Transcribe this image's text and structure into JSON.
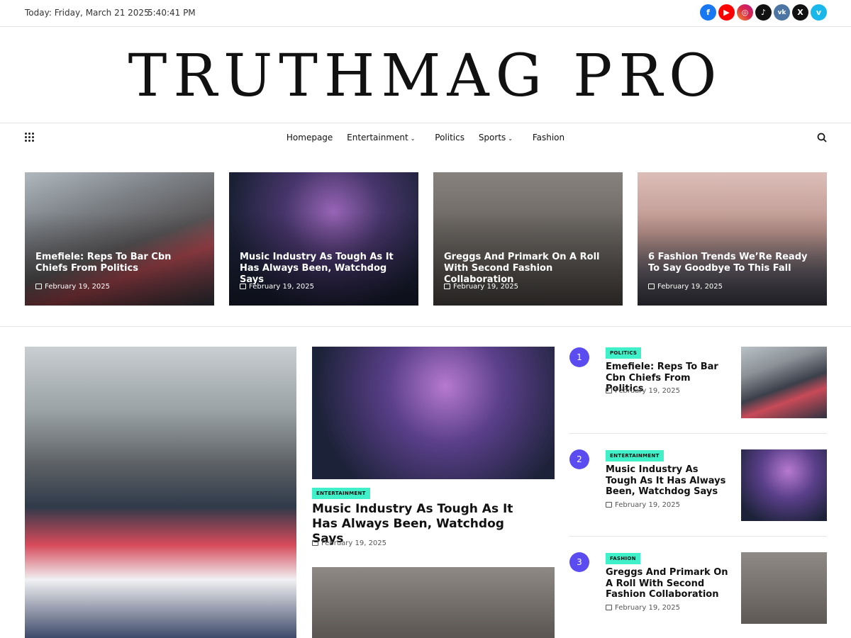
{
  "topbar": {
    "date": "Today: Friday, March 21 2025",
    "time": "5:40:41 PM",
    "socials": [
      {
        "name": "facebook",
        "glyph": "f",
        "color": "#1877f2"
      },
      {
        "name": "youtube",
        "glyph": "▶",
        "color": "#ff0000"
      },
      {
        "name": "instagram",
        "glyph": "◎",
        "color": "#c13584"
      },
      {
        "name": "tiktok",
        "glyph": "♪",
        "color": "#111111"
      },
      {
        "name": "vk",
        "glyph": "vk",
        "color": "#4c75a3"
      },
      {
        "name": "x",
        "glyph": "X",
        "color": "#111111"
      },
      {
        "name": "vimeo",
        "glyph": "v",
        "color": "#1ab7ea"
      }
    ]
  },
  "site": {
    "title": "TRUTHMAG PRO"
  },
  "nav": {
    "items": [
      {
        "label": "Homepage"
      },
      {
        "label": "Entertainment"
      },
      {
        "label": "Politics"
      },
      {
        "label": "Sports"
      },
      {
        "label": "Fashion"
      }
    ]
  },
  "featured": [
    {
      "title": "Emefiele: Reps To Bar Cbn Chiefs From Politics",
      "date": "February 19, 2025"
    },
    {
      "title": "Music Industry As Tough As It Has Always Been, Watchdog Says",
      "date": "February 19, 2025"
    },
    {
      "title": "Greggs And Primark On A Roll With Second Fashion Collaboration",
      "date": "February 19, 2025"
    },
    {
      "title": "6 Fashion Trends We’Re Ready To Say Goodbye To This Fall",
      "date": "February 19, 2025"
    }
  ],
  "middle": {
    "badge": "ENTERTAINMENT",
    "title": "Music Industry As Tough As It Has Always Been, Watchdog Says",
    "date": "February 19, 2025"
  },
  "ranked": [
    {
      "num": "1",
      "badge": "POLITICS",
      "title": "Emefiele: Reps To Bar Cbn Chiefs From Politics",
      "date": "February 19, 2025"
    },
    {
      "num": "2",
      "badge": "ENTERTAINMENT",
      "title": "Music Industry As Tough As It Has Always Been, Watchdog Says",
      "date": "February 19, 2025"
    },
    {
      "num": "3",
      "badge": "FASHION",
      "title": "Greggs And Primark On A Roll With Second Fashion Collaboration",
      "date": "February 19, 2025"
    }
  ],
  "colors": {
    "accent": "#2a6fb5",
    "badge": "#3ff0c8",
    "rank": "#5a4cf0"
  }
}
